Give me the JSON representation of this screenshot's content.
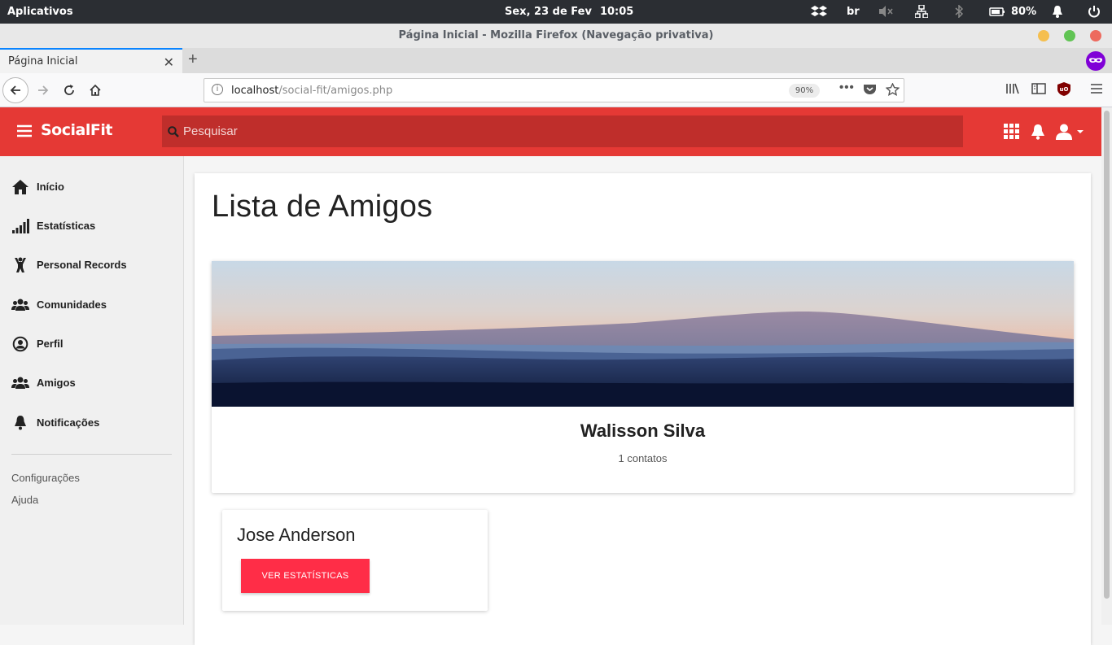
{
  "os": {
    "apps_label": "Aplicativos",
    "date": "Sex, 23 de Fev",
    "time": "10:05",
    "keyboard_layout": "br",
    "battery": "80%"
  },
  "browser": {
    "window_title": "Página Inicial - Mozilla Firefox (Navegação privativa)",
    "tab_title": "Página Inicial",
    "url_host": "localhost",
    "url_path": "/social-fit/amigos.php",
    "zoom": "90%"
  },
  "app": {
    "logo": "SocialFit",
    "search_placeholder": "Pesquisar",
    "brand_color": "#e53935"
  },
  "sidebar": {
    "items": [
      {
        "label": "Início",
        "icon": "home-icon"
      },
      {
        "label": "Estatísticas",
        "icon": "signal-bars-icon"
      },
      {
        "label": "Personal Records",
        "icon": "weightlifter-icon"
      },
      {
        "label": "Comunidades",
        "icon": "users-icon"
      },
      {
        "label": "Perfil",
        "icon": "user-circle-icon"
      },
      {
        "label": "Amigos",
        "icon": "users-icon"
      },
      {
        "label": "Notificações",
        "icon": "bell-icon"
      }
    ],
    "links": [
      "Configurações",
      "Ajuda"
    ]
  },
  "main": {
    "title": "Lista de Amigos",
    "profile": {
      "name": "Walisson Silva",
      "contacts": "1 contatos"
    },
    "friends": [
      {
        "name": "Jose Anderson",
        "button_label": "VER ESTATÍSTICAS"
      }
    ]
  }
}
